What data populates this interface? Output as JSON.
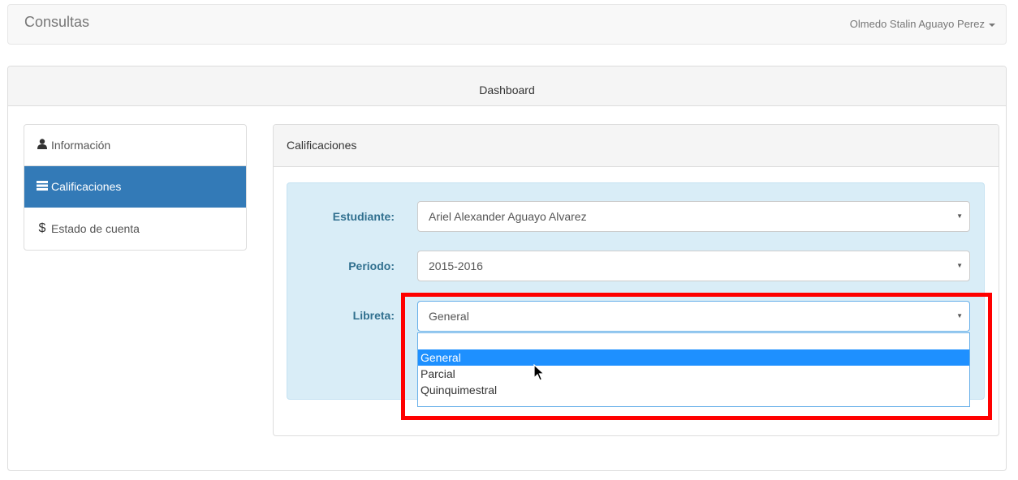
{
  "navbar": {
    "brand": "Consultas",
    "user": "Olmedo Stalin Aguayo Perez"
  },
  "panel": {
    "heading": "Dashboard"
  },
  "sidebar": {
    "items": [
      {
        "icon": "user-icon",
        "label": "Información",
        "active": false
      },
      {
        "icon": "list-icon",
        "label": "Calificaciones",
        "active": true
      },
      {
        "icon": "dollar-icon",
        "label": "Estado de cuenta",
        "active": false
      }
    ]
  },
  "calificaciones": {
    "heading": "Calificaciones",
    "form": {
      "estudiante": {
        "label": "Estudiante:",
        "value": "Ariel Alexander Aguayo Alvarez"
      },
      "periodo": {
        "label": "Periodo:",
        "value": "2015-2016"
      },
      "libreta": {
        "label": "Libreta:",
        "value": "General",
        "options": [
          "",
          "General",
          "Parcial",
          "Quinquimestral"
        ],
        "highlighted": "General"
      }
    }
  },
  "colors": {
    "primary": "#337ab7",
    "annotation": "#ff0000",
    "well": "#d9edf7",
    "option_highlight": "#1e90ff"
  }
}
